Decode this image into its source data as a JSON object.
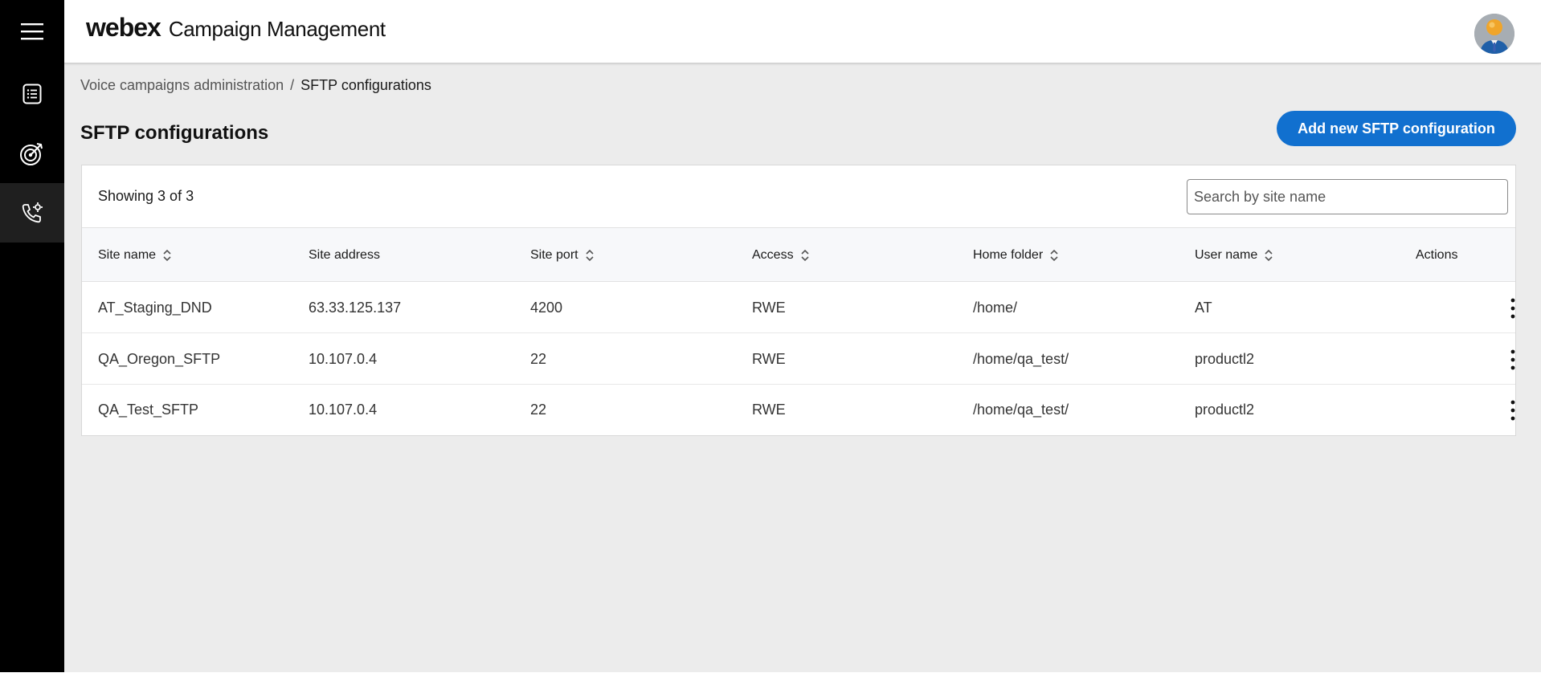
{
  "header": {
    "brand": "webex",
    "app_name": "Campaign Management"
  },
  "sidebar": {
    "items": [
      {
        "name": "menu",
        "icon": "hamburger-icon"
      },
      {
        "name": "reports",
        "icon": "list-document-icon"
      },
      {
        "name": "campaigns",
        "icon": "target-icon"
      },
      {
        "name": "voice-campaigns-administration",
        "icon": "phone-gear-icon",
        "active": true
      }
    ]
  },
  "breadcrumb": {
    "parent": "Voice campaigns administration",
    "separator": "/",
    "current": "SFTP configurations"
  },
  "page": {
    "title": "SFTP configurations",
    "add_button": "Add new SFTP configuration"
  },
  "table": {
    "showing": "Showing 3 of 3",
    "search_placeholder": "Search by site name",
    "columns": [
      {
        "label": "Site name",
        "sortable": true
      },
      {
        "label": "Site address",
        "sortable": false
      },
      {
        "label": "Site port",
        "sortable": true
      },
      {
        "label": "Access",
        "sortable": true
      },
      {
        "label": "Home folder",
        "sortable": true
      },
      {
        "label": "User name",
        "sortable": true
      },
      {
        "label": "Actions",
        "sortable": false
      }
    ],
    "rows": [
      {
        "site_name": "AT_Staging_DND",
        "site_address": "63.33.125.137",
        "site_port": "4200",
        "access": "RWE",
        "home_folder": "/home/",
        "user_name": "AT"
      },
      {
        "site_name": "QA_Oregon_SFTP",
        "site_address": "10.107.0.4",
        "site_port": "22",
        "access": "RWE",
        "home_folder": "/home/qa_test/",
        "user_name": "productl2"
      },
      {
        "site_name": "QA_Test_SFTP",
        "site_address": "10.107.0.4",
        "site_port": "22",
        "access": "RWE",
        "home_folder": "/home/qa_test/",
        "user_name": "productl2"
      }
    ]
  },
  "colors": {
    "sidebar_bg": "#000000",
    "sidebar_active_bg": "#1f1f1f",
    "primary_button": "#1170cf",
    "page_bg": "#ececec"
  }
}
